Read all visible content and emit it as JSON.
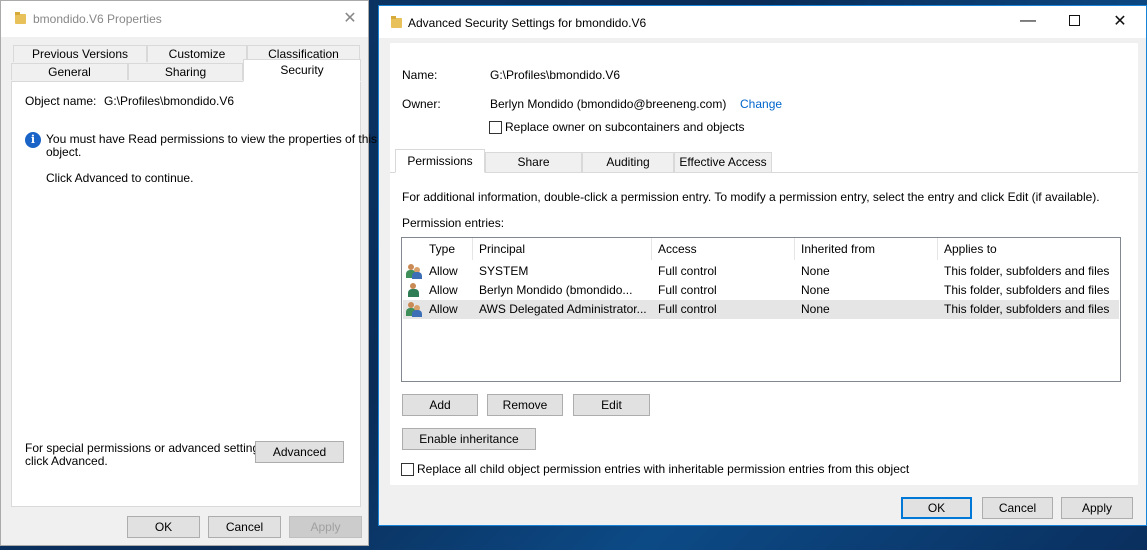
{
  "props": {
    "title": "bmondido.V6 Properties",
    "tabs_row1": [
      "Previous Versions",
      "Customize",
      "Classification"
    ],
    "tabs_row2": [
      "General",
      "Sharing",
      "Security"
    ],
    "object_name_label": "Object name:",
    "object_name_value": "G:\\Profiles\\bmondido.V6",
    "info_line1": "You must have Read permissions to view the properties of this",
    "info_line2": "object.",
    "continue_text": "Click Advanced to continue.",
    "special_line1": "For special permissions or advanced settings,",
    "special_line2": "click Advanced.",
    "advanced_button": "Advanced",
    "ok": "OK",
    "cancel": "Cancel",
    "apply": "Apply"
  },
  "adv": {
    "title": "Advanced Security Settings for bmondido.V6",
    "name_label": "Name:",
    "name_value": "G:\\Profiles\\bmondido.V6",
    "owner_label": "Owner:",
    "owner_value": "Berlyn Mondido (bmondido@breeneng.com)",
    "change_link": "Change",
    "replace_owner": "Replace owner on subcontainers and objects",
    "tabs": [
      "Permissions",
      "Share",
      "Auditing",
      "Effective Access"
    ],
    "info_text": "For additional information, double-click a permission entry. To modify a permission entry, select the entry and click Edit (if available).",
    "entries_label": "Permission entries:",
    "columns": [
      "Type",
      "Principal",
      "Access",
      "Inherited from",
      "Applies to"
    ],
    "rows": [
      {
        "type": "Allow",
        "principal": "SYSTEM",
        "access": "Full control",
        "inherited": "None",
        "applies": "This folder, subfolders and files",
        "icon": "group-icon"
      },
      {
        "type": "Allow",
        "principal": "Berlyn Mondido (bmondido...",
        "access": "Full control",
        "inherited": "None",
        "applies": "This folder, subfolders and files",
        "icon": "user-icon"
      },
      {
        "type": "Allow",
        "principal": "AWS Delegated Administrator...",
        "access": "Full control",
        "inherited": "None",
        "applies": "This folder, subfolders and files",
        "icon": "group-icon"
      }
    ],
    "add": "Add",
    "remove": "Remove",
    "edit": "Edit",
    "enable_inheritance": "Enable inheritance",
    "replace_child": "Replace all child object permission entries with inheritable permission entries from this object",
    "ok": "OK",
    "cancel": "Cancel",
    "apply": "Apply"
  }
}
